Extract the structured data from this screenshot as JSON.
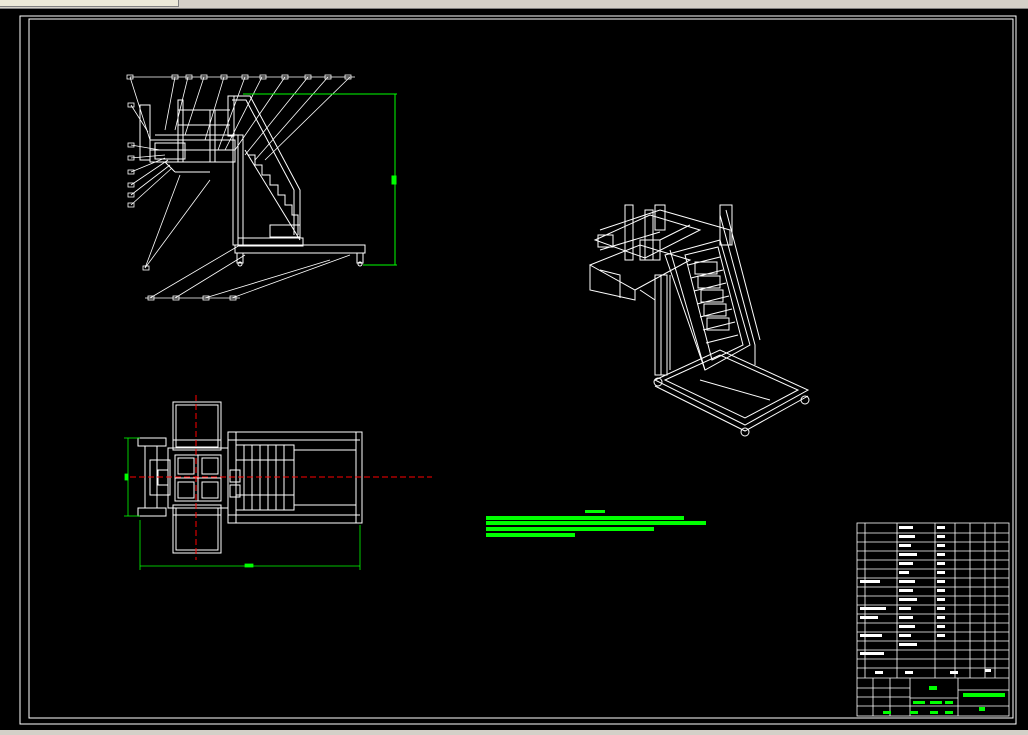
{
  "window": {
    "tab_label": ""
  },
  "drawing": {
    "background": "#000000",
    "line_color": "#ffffff",
    "dimension_color": "#00ff00",
    "centerline_color": "#ff0000",
    "views": [
      "side-elevation",
      "top-plan",
      "isometric"
    ],
    "title_block": {
      "rows": 16
    }
  }
}
